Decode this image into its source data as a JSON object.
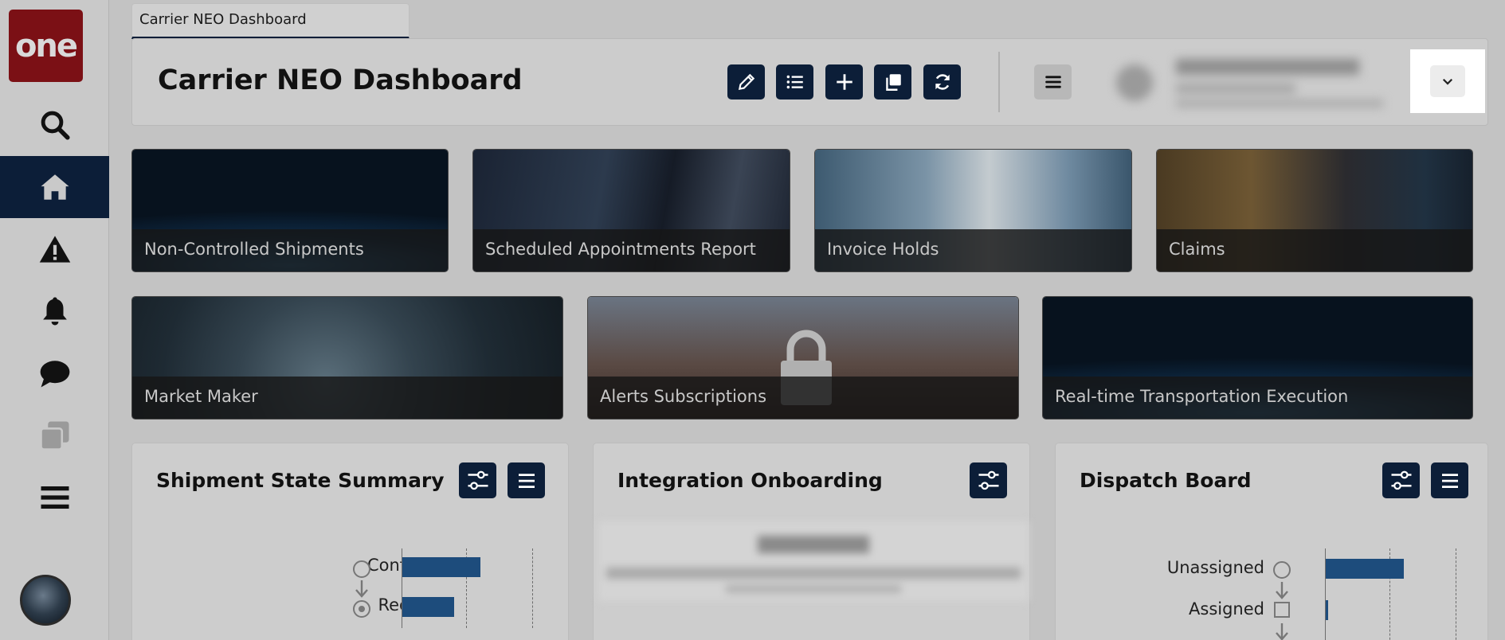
{
  "app": {
    "logo_text": "one",
    "tab_label": "Carrier NEO Dashboard"
  },
  "sidebar": {
    "items": [
      {
        "icon": "search-icon"
      },
      {
        "icon": "home-icon",
        "active": true
      },
      {
        "icon": "alert-icon"
      },
      {
        "icon": "bell-icon"
      },
      {
        "icon": "chat-icon"
      },
      {
        "icon": "copy-icon"
      },
      {
        "icon": "menu-icon"
      }
    ]
  },
  "header": {
    "title": "Carrier NEO Dashboard",
    "toolbar": [
      "pencil-icon",
      "list-icon",
      "plus-icon",
      "copy-icon",
      "refresh-icon"
    ]
  },
  "tiles": [
    {
      "label": "Non-Controlled Shipments"
    },
    {
      "label": "Scheduled Appointments Report"
    },
    {
      "label": "Invoice Holds"
    },
    {
      "label": "Claims"
    },
    {
      "label": "Market Maker"
    },
    {
      "label": "Alerts Subscriptions"
    },
    {
      "label": "Real-time Transportation Execution"
    }
  ],
  "widgets": {
    "shipment_state": {
      "title": "Shipment State Summary",
      "states": [
        {
          "label": "Confirmed",
          "value": 0.6
        },
        {
          "label": "Received",
          "value": 0.4
        }
      ]
    },
    "integration": {
      "title": "Integration Onboarding"
    },
    "dispatch": {
      "title": "Dispatch Board",
      "states": [
        {
          "label": "Unassigned",
          "value": 0.6
        },
        {
          "label": "Assigned",
          "value": 0.02
        }
      ]
    }
  },
  "colors": {
    "navy": "#0c1e38",
    "bar": "#1d4c7c",
    "logo": "#7b1015"
  }
}
